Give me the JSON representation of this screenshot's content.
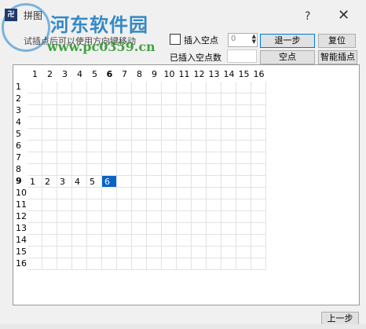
{
  "window": {
    "title": "拼图",
    "help": "?",
    "close": "✕"
  },
  "watermark": {
    "brand": "河东软件园",
    "url": "www.pc0359.cn"
  },
  "hint": "试插点后可以使用方向键移动",
  "controls": {
    "insert_space_label": "插入空点",
    "insert_space_value": "0",
    "back_step": "退一步",
    "reset": "复位",
    "inserted_label": "已插入空点数",
    "inserted_value": "",
    "space": "空点",
    "smart_insert": "智能插点"
  },
  "grid": {
    "columns": [
      "1",
      "2",
      "3",
      "4",
      "5",
      "6",
      "7",
      "8",
      "9",
      "10",
      "11",
      "12",
      "13",
      "14",
      "15",
      "16"
    ],
    "rows": [
      "1",
      "2",
      "3",
      "4",
      "5",
      "6",
      "7",
      "8",
      "9",
      "10",
      "11",
      "12",
      "13",
      "14",
      "15",
      "16"
    ],
    "bold_column": "6",
    "bold_row": "9",
    "filled_row": "9",
    "filled_values": [
      "1",
      "2",
      "3",
      "4",
      "5",
      "6"
    ],
    "selected_value": "6"
  },
  "footer": {
    "prev_step": "上一步"
  }
}
